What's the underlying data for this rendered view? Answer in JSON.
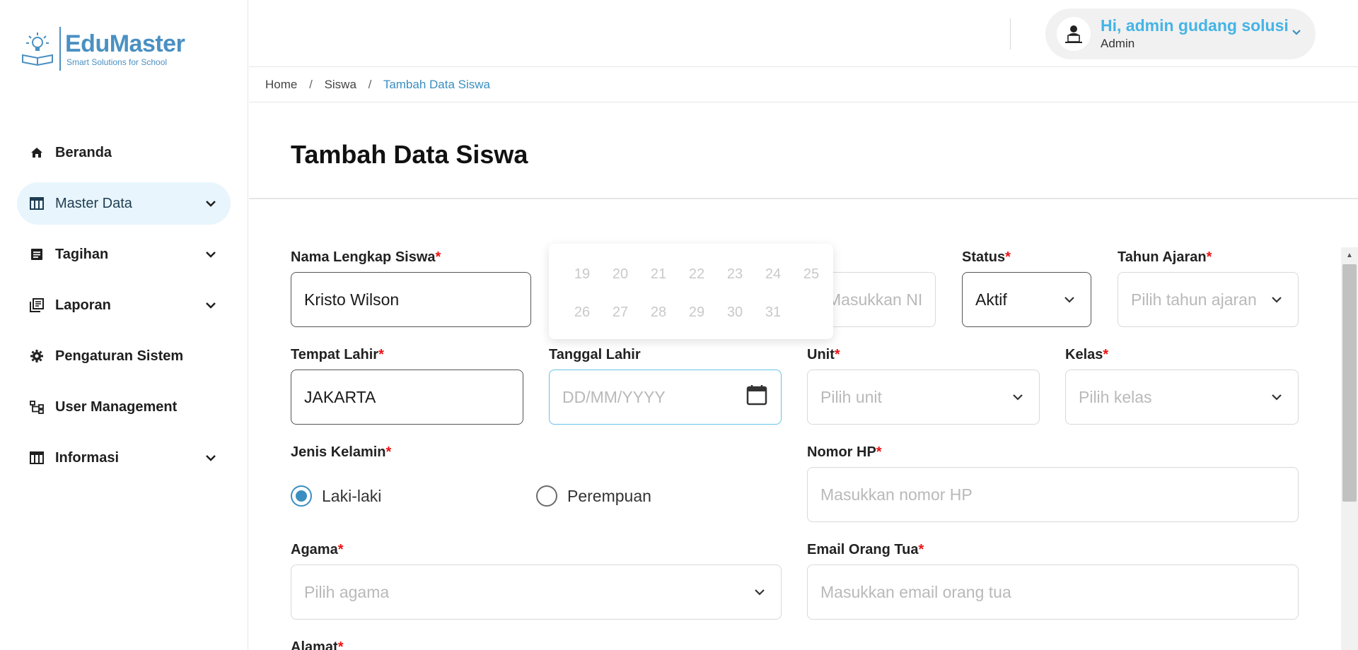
{
  "brand": {
    "name": "EduMaster",
    "tagline": "Smart Solutions for School",
    "color": "#4a90c2"
  },
  "sidebar": {
    "items": [
      {
        "label": "Beranda",
        "icon": "home-icon",
        "has_chevron": false,
        "active": false
      },
      {
        "label": "Master Data",
        "icon": "table-icon",
        "has_chevron": true,
        "active": true
      },
      {
        "label": "Tagihan",
        "icon": "receipt-icon",
        "has_chevron": true,
        "active": false
      },
      {
        "label": "Laporan",
        "icon": "report-icon",
        "has_chevron": true,
        "active": false
      },
      {
        "label": "Pengaturan Sistem",
        "icon": "gear-icon",
        "has_chevron": false,
        "active": false
      },
      {
        "label": "User Management",
        "icon": "hierarchy-icon",
        "has_chevron": false,
        "active": false
      },
      {
        "label": "Informasi",
        "icon": "table-icon",
        "has_chevron": true,
        "active": false
      }
    ]
  },
  "header": {
    "user_greeting": "Hi, admin gudang solusi",
    "user_role": "Admin"
  },
  "breadcrumb": {
    "home": "Home",
    "section": "Siswa",
    "current": "Tambah Data Siswa",
    "separator": "/"
  },
  "page": {
    "title": "Tambah Data Siswa"
  },
  "form": {
    "nama": {
      "label": "Nama Lengkap Siswa",
      "value": "Kristo Wilson"
    },
    "nis": {
      "placeholder": "Masukkan NIS"
    },
    "status": {
      "label": "Status",
      "value": "Aktif"
    },
    "tahun_ajaran": {
      "label": "Tahun Ajaran",
      "placeholder": "Pilih tahun ajaran"
    },
    "tempat_lahir": {
      "label": "Tempat Lahir",
      "value": "JAKARTA"
    },
    "tanggal_lahir": {
      "label": "Tanggal Lahir",
      "placeholder": "DD/MM/YYYY"
    },
    "unit": {
      "label": "Unit",
      "placeholder": "Pilih unit"
    },
    "kelas": {
      "label": "Kelas",
      "placeholder": "Pilih kelas"
    },
    "jenis_kelamin": {
      "label": "Jenis Kelamin",
      "options": [
        "Laki-laki",
        "Perempuan"
      ],
      "selected": "Laki-laki"
    },
    "nomor_hp": {
      "label": "Nomor HP",
      "placeholder": "Masukkan nomor HP"
    },
    "agama": {
      "label": "Agama",
      "placeholder": "Pilih agama"
    },
    "email_ortu": {
      "label": "Email Orang Tua",
      "placeholder": "Masukkan email orang tua"
    },
    "alamat": {
      "label": "Alamat"
    },
    "required_mark": "*"
  },
  "calendar": {
    "row1": [
      "19",
      "20",
      "21",
      "22",
      "23",
      "24",
      "25"
    ],
    "row2": [
      "26",
      "27",
      "28",
      "29",
      "30",
      "31"
    ]
  },
  "colors": {
    "accent": "#45b4e6",
    "active_nav_bg": "#e8f5fc",
    "required": "#e11111",
    "radio_on": "#3a8fc0"
  }
}
